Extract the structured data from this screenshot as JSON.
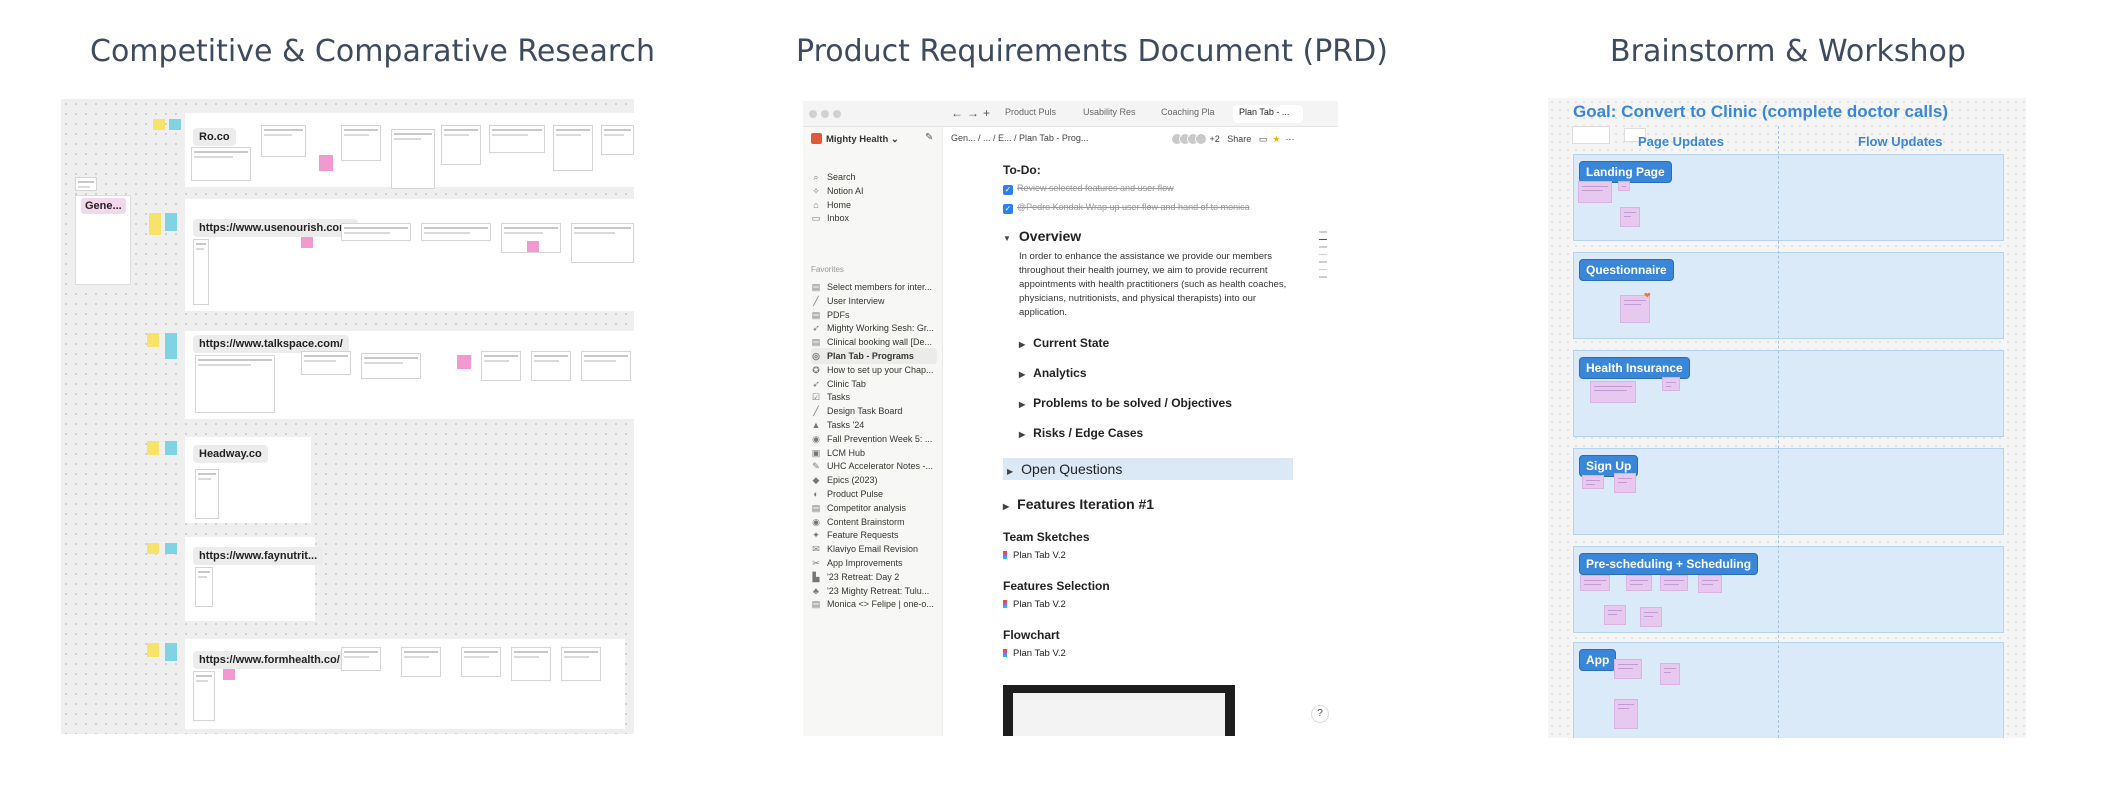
{
  "titles": {
    "research": "Competitive & Comparative Research",
    "prd": "Product Requirements Document (PRD)",
    "brainstorm": "Brainstorm & Workshop"
  },
  "research_board": {
    "gene_label": "Gene...",
    "rows": [
      {
        "label": "Ro.co"
      },
      {
        "label": "https://www.usenourish.com/"
      },
      {
        "label": "https://www.talkspace.com/"
      },
      {
        "label": "Headway.co"
      },
      {
        "label": "https://www.faynutrit..."
      },
      {
        "label": "https://www.formhealth.co/"
      }
    ]
  },
  "notion": {
    "tabs": [
      {
        "label": "Product Puls"
      },
      {
        "label": "Usability Res"
      },
      {
        "label": "Coaching Pla"
      },
      {
        "label": "Plan Tab - ..."
      }
    ],
    "workspace": "Mighty Health",
    "sidebar_top": [
      {
        "icon": "⌕",
        "label": "Search"
      },
      {
        "icon": "✧",
        "label": "Notion AI"
      },
      {
        "icon": "⌂",
        "label": "Home"
      },
      {
        "icon": "▭",
        "label": "Inbox"
      }
    ],
    "favorites_label": "Favorites",
    "favorites": [
      {
        "icon": "▤",
        "label": "Select members for inter..."
      },
      {
        "icon": "╱",
        "label": "User Interview"
      },
      {
        "icon": "▤",
        "label": "PDFs"
      },
      {
        "icon": "➶",
        "label": "Mighty Working Sesh: Gr..."
      },
      {
        "icon": "▤",
        "label": "Clinical booking wall [De..."
      },
      {
        "icon": "◎",
        "label": "Plan Tab - Programs"
      },
      {
        "icon": "✪",
        "label": "How to set up your Chap..."
      },
      {
        "icon": "➶",
        "label": "Clinic Tab"
      },
      {
        "icon": "☑",
        "label": "Tasks"
      },
      {
        "icon": "╱",
        "label": "Design Task Board"
      },
      {
        "icon": "▲",
        "label": "Tasks '24"
      },
      {
        "icon": "◉",
        "label": "Fall Prevention Week 5: ..."
      },
      {
        "icon": "▣",
        "label": "LCM Hub"
      },
      {
        "icon": "✎",
        "label": "UHC Accelerator Notes -..."
      },
      {
        "icon": "◆",
        "label": "Epics (2023)"
      },
      {
        "icon": "◐",
        "label": "Product Pulse"
      },
      {
        "icon": "▤",
        "label": "Competitor analysis"
      },
      {
        "icon": "◉",
        "label": "Content Brainstorm"
      },
      {
        "icon": "✦",
        "label": "Feature Requests"
      },
      {
        "icon": "✉",
        "label": "Klaviyo Email Revision"
      },
      {
        "icon": "✂",
        "label": "App Improvements"
      },
      {
        "icon": "▙",
        "label": "'23 Retreat: Day 2"
      },
      {
        "icon": "♣",
        "label": "'23 Mighty Retreat: Tulu..."
      },
      {
        "icon": "▤",
        "label": "Monica <> Felipe | one-o..."
      }
    ],
    "selected_index": 5,
    "breadcrumb": "Gen...   /  ...  /   E...   /   Plan Tab - Prog...",
    "page_actions": {
      "more_count": "+2",
      "share": "Share"
    },
    "todo_heading": "To-Do:",
    "todos": [
      "Review selected features and user flow",
      "@Pedro Kondak Wrap up user flow and hand of to monica"
    ],
    "overview_heading": "Overview",
    "overview_text": "In order to enhance the assistance we provide our members throughout their health journey, we aim to provide recurrent appointments with health practitioners (such as health coaches, physicians, nutritionists, and physical therapists) into our application.",
    "subsections": [
      "Current State",
      "Analytics",
      "Problems to be solved / Objectives",
      "Risks / Edge Cases"
    ],
    "open_questions": "Open Questions",
    "features_iteration": "Features Iteration #1",
    "sections": [
      {
        "heading": "Team Sketches",
        "link": "Plan Tab V.2"
      },
      {
        "heading": "Features Selection",
        "link": "Plan Tab V.2"
      },
      {
        "heading": "Flowchart",
        "link": "Plan Tab V.2"
      }
    ]
  },
  "brainstorm": {
    "goal": "Goal: Convert to Clinic (complete doctor calls)",
    "col_left": "Page Updates",
    "col_right": "Flow Updates",
    "lanes": [
      {
        "label": "Landing Page"
      },
      {
        "label": "Questionnaire"
      },
      {
        "label": "Health Insurance"
      },
      {
        "label": "Sign Up"
      },
      {
        "label": "Pre-scheduling + Scheduling"
      },
      {
        "label": "App"
      }
    ]
  }
}
